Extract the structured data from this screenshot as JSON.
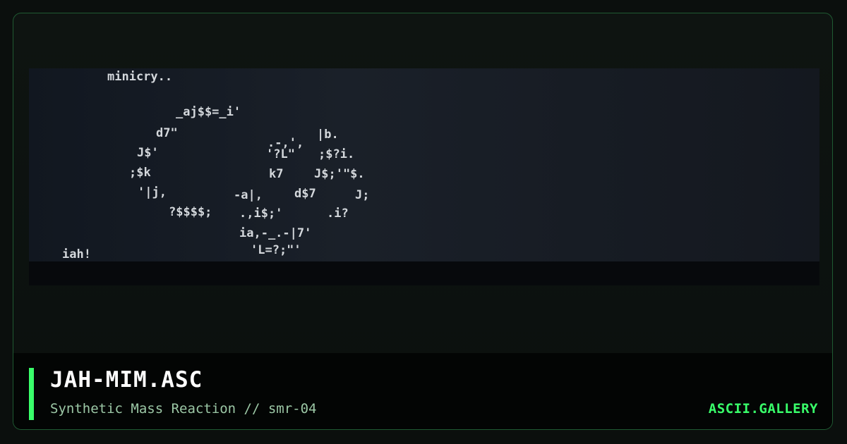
{
  "artwork": {
    "lines": [
      "minicry..",
      "_aj$$=_i'",
      "d7\"",
      "J$'",
      ";$k",
      "'|j,",
      "?$$$$;",
      ".-,',",
      "|b.",
      "'?L\"",
      ";$?i.",
      "k7",
      "J$;'\"$.",
      "-a|,",
      "d$7",
      "J;",
      ".,i$;'",
      ".i?",
      "ia,-_.-|7'",
      "'L=?;\"'",
      "iah!"
    ]
  },
  "card": {
    "title": "JAH-MIM.ASC",
    "subtitle": "Synthetic Mass Reaction // smr-04",
    "brand": "ASCII.GALLERY"
  },
  "colors": {
    "accent": "#39ff6a",
    "art_text": "#d4d8dc",
    "border": "#1f5a32"
  }
}
